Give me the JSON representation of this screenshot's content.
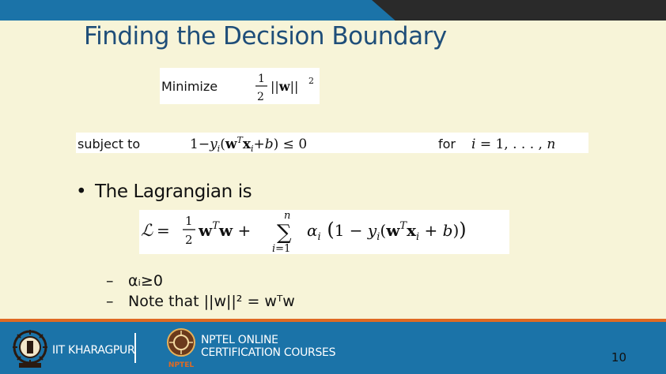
{
  "slide": {
    "title": "Finding the Decision Boundary",
    "equation_minimize": "Minimize ½||w||²",
    "equation_constraint": "subject to 1−yᵢ(wᵀxᵢ+b) ≤ 0 for i = 1,...,n",
    "bullet": "The Lagrangian is",
    "equation_lagrangian": "ℒ = ½wᵀw + Σ αᵢ(1 − yᵢ(wᵀxᵢ + b))",
    "subbullets": [
      "αᵢ≥0",
      "Note that ||w||² = wᵀw"
    ]
  },
  "footer": {
    "institute": "IIT KHARAGPUR",
    "program_line1": "NPTEL ONLINE",
    "program_line2": "CERTIFICATION COURSES",
    "nptel_logo_text": "NPTEL",
    "page_number": "10"
  },
  "colors": {
    "background": "#f7f4d8",
    "title": "#1f4e79",
    "footer": "#1b73a8",
    "accent": "#e06a23"
  }
}
